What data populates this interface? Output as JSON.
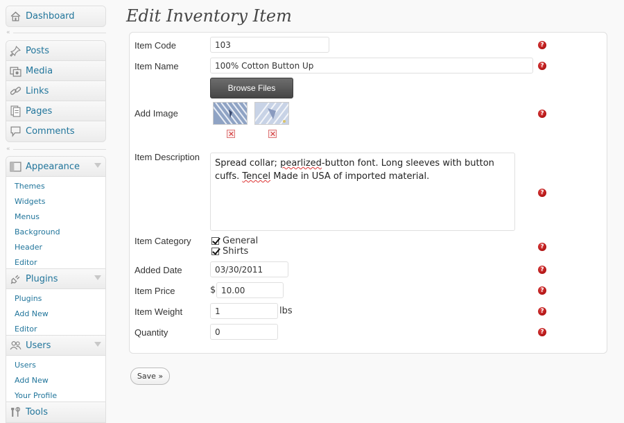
{
  "sidebar": {
    "dashboard": {
      "label": "Dashboard",
      "icon": "house-icon"
    },
    "group1": [
      {
        "label": "Posts",
        "icon": "pin-icon"
      },
      {
        "label": "Media",
        "icon": "media-icon"
      },
      {
        "label": "Links",
        "icon": "link-icon"
      },
      {
        "label": "Pages",
        "icon": "pages-icon"
      },
      {
        "label": "Comments",
        "icon": "comment-icon"
      }
    ],
    "appearance": {
      "label": "Appearance",
      "icon": "appearance-icon",
      "items": [
        "Themes",
        "Widgets",
        "Menus",
        "Background",
        "Header",
        "Editor"
      ]
    },
    "plugins": {
      "label": "Plugins",
      "icon": "plug-icon",
      "items": [
        "Plugins",
        "Add New",
        "Editor"
      ]
    },
    "users": {
      "label": "Users",
      "icon": "users-icon",
      "items": [
        "Users",
        "Add New",
        "Your Profile"
      ]
    },
    "tools": {
      "label": "Tools",
      "icon": "tools-icon"
    }
  },
  "page": {
    "title": "Edit Inventory Item"
  },
  "form": {
    "item_code": {
      "label": "Item Code",
      "value": "103"
    },
    "item_name": {
      "label": "Item Name",
      "value": "100% Cotton Button Up"
    },
    "image": {
      "label": "Add Image",
      "browse_label": "Browse Files"
    },
    "description": {
      "label": "Item Description",
      "part1": "Spread collar; ",
      "word1": "pearlized",
      "part2": "-button font. Long sleeves with button cuffs. ",
      "word2": "Tencel",
      "part3": " Made in USA of imported material."
    },
    "category": {
      "label": "Item Category",
      "options": [
        {
          "label": "General",
          "checked": true
        },
        {
          "label": "Shirts",
          "checked": true
        }
      ]
    },
    "added_date": {
      "label": "Added Date",
      "value": "03/30/2011"
    },
    "price": {
      "label": "Item Price",
      "currency": "$",
      "value": "10.00"
    },
    "weight": {
      "label": "Item Weight",
      "value": "1",
      "unit": "lbs"
    },
    "quantity": {
      "label": "Quantity",
      "value": "0"
    },
    "help_glyph": "?",
    "save_label": "Save »"
  },
  "colors": {
    "link": "#21759b",
    "help": "#b00000",
    "border": "#dfdfdf"
  }
}
